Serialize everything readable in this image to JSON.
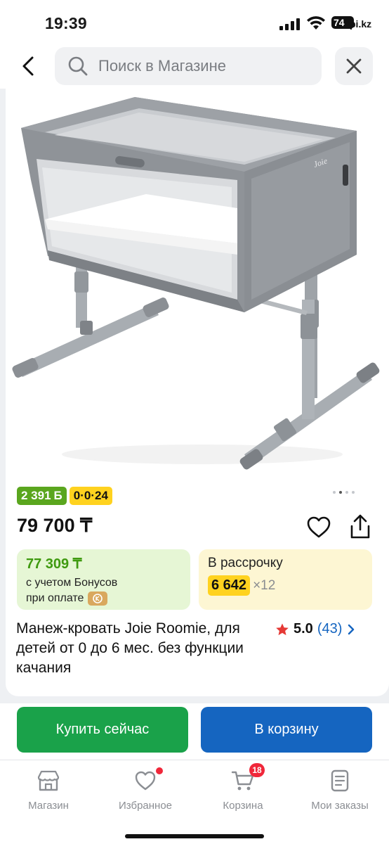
{
  "status_bar": {
    "time": "19:39",
    "battery": "74",
    "watermark": "pi.kz"
  },
  "search": {
    "placeholder": "Поиск в Магазине"
  },
  "product": {
    "badge_bonus": "2 391",
    "badge_bonus_currency": "Б",
    "badge_installment": "0·0·24",
    "price": "79 700 ₸",
    "bonus_price": "77 309 ₸",
    "bonus_line1": "с учетом Бонусов",
    "bonus_line2": "при оплате",
    "credit_title": "В рассрочку",
    "credit_monthly": "6 642",
    "credit_months": "×12",
    "title": "Манеж-кровать Joie Roomie, для детей от 0 до 6 мес. без функции качания",
    "rating": "5.0",
    "reviews": "(43)",
    "image_brand": "Joie",
    "image_dots": {
      "total": 4,
      "active_index": 1
    }
  },
  "actions": {
    "buy_now": "Купить сейчас",
    "add_to_cart": "В корзину"
  },
  "nav": {
    "items": [
      {
        "label": "Магазин",
        "icon": "store-icon"
      },
      {
        "label": "Избранное",
        "icon": "heart-icon"
      },
      {
        "label": "Корзина",
        "icon": "cart-icon",
        "badge": "18"
      },
      {
        "label": "Мои заказы",
        "icon": "orders-icon"
      }
    ]
  },
  "colors": {
    "green": "#1aa24a",
    "blue": "#1565c0",
    "yellow": "#ffd21f",
    "red": "#f0273a"
  }
}
